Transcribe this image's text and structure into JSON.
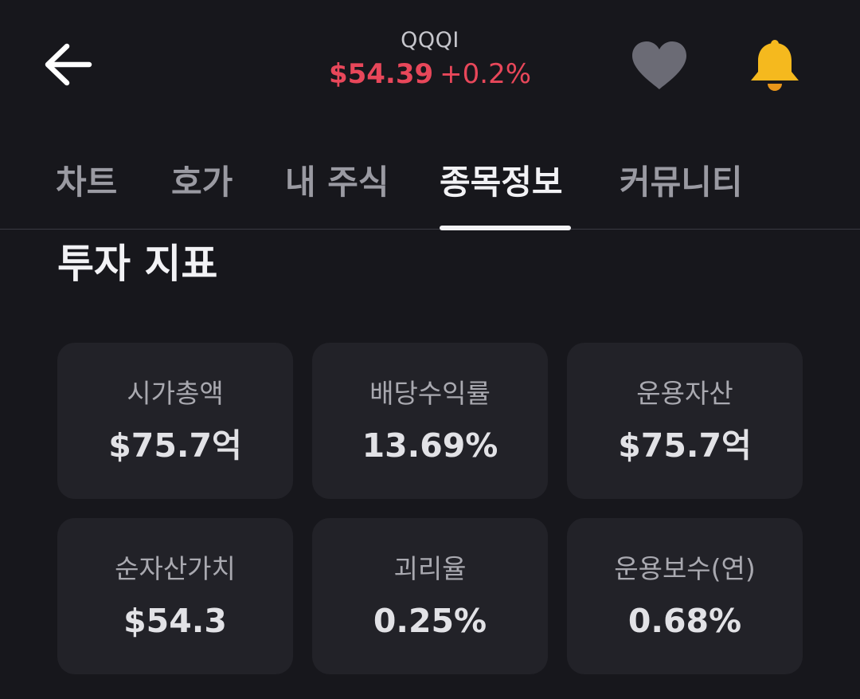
{
  "header": {
    "ticker": "QQQI",
    "price": "$54.39",
    "change": "+0.2%",
    "price_color": "#e8475a",
    "icons": {
      "back": "arrow-left-icon",
      "favorite": "heart-icon",
      "alert": "bell-icon"
    },
    "heart_color": "#6b6b75",
    "bell_color": "#f5b91e"
  },
  "tabs": [
    {
      "label": "차트",
      "active": false
    },
    {
      "label": "호가",
      "active": false
    },
    {
      "label": "내 주식",
      "active": false
    },
    {
      "label": "종목정보",
      "active": true
    },
    {
      "label": "커뮤니티",
      "active": false
    }
  ],
  "section": {
    "title": "투자 지표"
  },
  "metrics": [
    {
      "label": "시가총액",
      "value": "$75.7억"
    },
    {
      "label": "배당수익률",
      "value": "13.69%"
    },
    {
      "label": "운용자산",
      "value": "$75.7억"
    },
    {
      "label": "순자산가치",
      "value": "$54.3"
    },
    {
      "label": "괴리율",
      "value": "0.25%"
    },
    {
      "label": "운용보수(연)",
      "value": "0.68%"
    }
  ]
}
